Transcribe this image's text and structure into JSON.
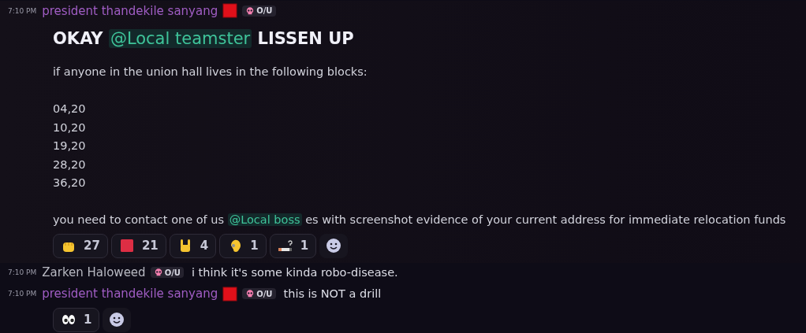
{
  "messages": [
    {
      "time": "7:10 PM",
      "author": "president thandekile sanyang",
      "color": "#a05dc4",
      "role_icon": true,
      "tag": "O/U",
      "highlighted": true,
      "lines": [
        {
          "kind": "heading",
          "parts": [
            {
              "text": "OKAY "
            },
            {
              "mention": "@Local teamster"
            },
            {
              "text": " LISSEN UP"
            }
          ]
        },
        {
          "kind": "text",
          "parts": [
            {
              "text": "if anyone in the union hall lives in the following blocks:"
            }
          ]
        },
        {
          "kind": "spacer"
        },
        {
          "kind": "text",
          "parts": [
            {
              "text": "04,20"
            }
          ]
        },
        {
          "kind": "text",
          "parts": [
            {
              "text": "10,20"
            }
          ]
        },
        {
          "kind": "text",
          "parts": [
            {
              "text": "19,20"
            }
          ]
        },
        {
          "kind": "text",
          "parts": [
            {
              "text": "28,20"
            }
          ]
        },
        {
          "kind": "text",
          "parts": [
            {
              "text": "36,20"
            }
          ]
        },
        {
          "kind": "spacer"
        },
        {
          "kind": "text",
          "parts": [
            {
              "text": "you need to contact one of us "
            },
            {
              "mention": "@Local boss"
            },
            {
              "text": " es with screenshot evidence of your current address for immediate relocation funds"
            }
          ]
        }
      ],
      "reactions": [
        {
          "kind": "fist",
          "count": "27"
        },
        {
          "kind": "square",
          "count": "21"
        },
        {
          "kind": "rock",
          "count": "4"
        },
        {
          "kind": "ear",
          "count": "1"
        },
        {
          "kind": "cigarette",
          "count": "1"
        }
      ],
      "add_reaction": true
    },
    {
      "time": "7:10 PM",
      "author": "Zarken Haloweed",
      "color": "#b8b9c2",
      "role_icon": false,
      "tag": "O/U",
      "highlighted": false,
      "inline": "i think it's some kinda robo-disease."
    },
    {
      "time": "7:10 PM",
      "author": "president thandekile sanyang",
      "color": "#a05dc4",
      "role_icon": true,
      "tag": "O/U",
      "highlighted": false,
      "inline": "this is NOT a drill",
      "reactions": [
        {
          "kind": "eyes",
          "count": "1"
        }
      ],
      "add_reaction": true
    }
  ]
}
